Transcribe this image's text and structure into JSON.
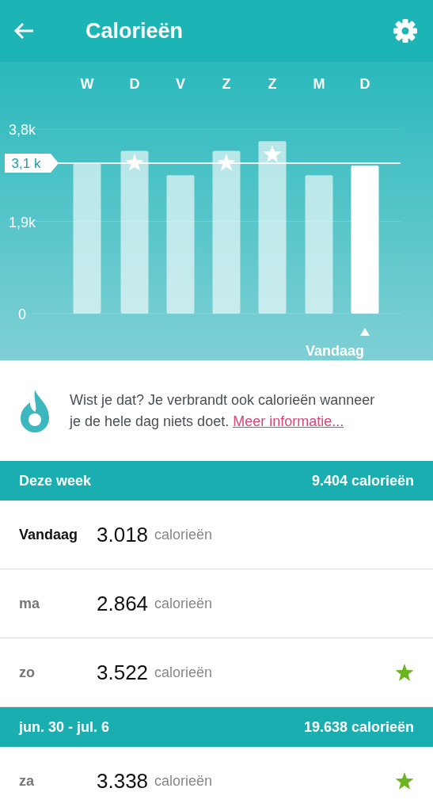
{
  "header": {
    "title": "Calorieën"
  },
  "chart_data": {
    "type": "bar",
    "categories": [
      "W",
      "D",
      "V",
      "Z",
      "Z",
      "M",
      "D"
    ],
    "values": [
      3100,
      3350,
      2850,
      3350,
      3550,
      2850,
      3050
    ],
    "ylim": [
      0,
      3800
    ],
    "yticks": [
      {
        "value": 0,
        "label": "0"
      },
      {
        "value": 1900,
        "label": "1,9k"
      },
      {
        "value": 3800,
        "label": "3,8k"
      }
    ],
    "ref_lines": [
      {
        "axis": "y",
        "value": 3100,
        "label": "3,1 k"
      }
    ]
  },
  "chart_days": [
    {
      "goal_met": false,
      "today": false
    },
    {
      "goal_met": true,
      "today": false
    },
    {
      "goal_met": false,
      "today": false
    },
    {
      "goal_met": true,
      "today": false
    },
    {
      "goal_met": true,
      "today": false
    },
    {
      "goal_met": false,
      "today": false
    },
    {
      "goal_met": false,
      "today": true
    }
  ],
  "today_label": "Vandaag",
  "tip": {
    "text": "Wist je dat? Je verbrandt ook calorieën wanneer je de hele dag niets doet.",
    "link": "Meer informatie..."
  },
  "sections": [
    {
      "title": "Deze week",
      "total": "9.404 calorieën",
      "rows": [
        {
          "day": "Vandaag",
          "today": true,
          "value": "3.018",
          "unit": "calorieën",
          "goal_met": false
        },
        {
          "day": "ma",
          "today": false,
          "value": "2.864",
          "unit": "calorieën",
          "goal_met": false
        },
        {
          "day": "zo",
          "today": false,
          "value": "3.522",
          "unit": "calorieën",
          "goal_met": true
        }
      ]
    },
    {
      "title": "jun. 30 - jul. 6",
      "total": "19.638 calorieën",
      "rows": [
        {
          "day": "za",
          "today": false,
          "value": "3.338",
          "unit": "calorieën",
          "goal_met": true
        }
      ]
    }
  ]
}
